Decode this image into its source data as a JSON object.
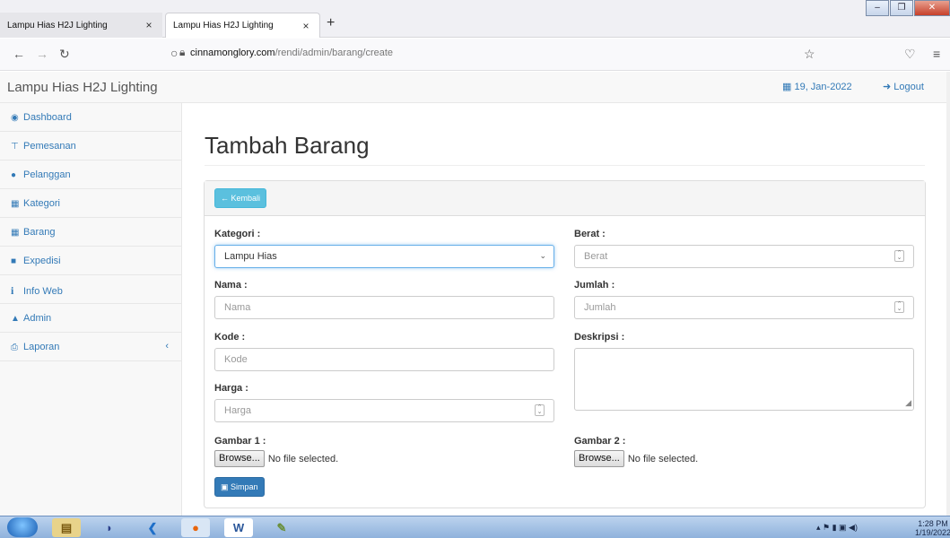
{
  "browser": {
    "tabs": [
      {
        "title": "Lampu Hias H2J Lighting",
        "active": false
      },
      {
        "title": "Lampu Hias H2J Lighting",
        "active": true
      }
    ],
    "url_host": "cinnamonglory.com",
    "url_path": "/rendi/admin/barang/create"
  },
  "header": {
    "brand": "Lampu Hias H2J Lighting",
    "date": "19, Jan-2022",
    "logout": "Logout"
  },
  "sidebar": {
    "items": [
      {
        "label": "Dashboard",
        "icon": "tachometer-icon"
      },
      {
        "label": "Pemesanan",
        "icon": "cart-icon"
      },
      {
        "label": "Pelanggan",
        "icon": "users-icon"
      },
      {
        "label": "Kategori",
        "icon": "table-icon"
      },
      {
        "label": "Barang",
        "icon": "table-icon"
      },
      {
        "label": "Expedisi",
        "icon": "truck-icon"
      },
      {
        "label": "Info Web",
        "icon": "info-icon"
      },
      {
        "label": "Admin",
        "icon": "user-icon"
      },
      {
        "label": "Laporan",
        "icon": "print-icon"
      }
    ]
  },
  "main": {
    "title": "Tambah Barang",
    "back_label": "Kembali",
    "form": {
      "kategori_label": "Kategori :",
      "kategori_value": "Lampu Hias",
      "nama_label": "Nama :",
      "nama_placeholder": "Nama",
      "kode_label": "Kode :",
      "kode_placeholder": "Kode",
      "harga_label": "Harga :",
      "harga_placeholder": "Harga",
      "berat_label": "Berat :",
      "berat_placeholder": "Berat",
      "jumlah_label": "Jumlah :",
      "jumlah_placeholder": "Jumlah",
      "deskripsi_label": "Deskripsi :",
      "gambar1_label": "Gambar 1 :",
      "gambar2_label": "Gambar 2 :",
      "browse_label": "Browse...",
      "no_file": "No file selected."
    },
    "save_label": "Simpan"
  },
  "taskbar": {
    "time": "1:28 PM",
    "date": "1/19/2022"
  },
  "colors": {
    "link": "#337ab7",
    "info_button": "#5bc0de",
    "primary_button": "#337ab7"
  }
}
